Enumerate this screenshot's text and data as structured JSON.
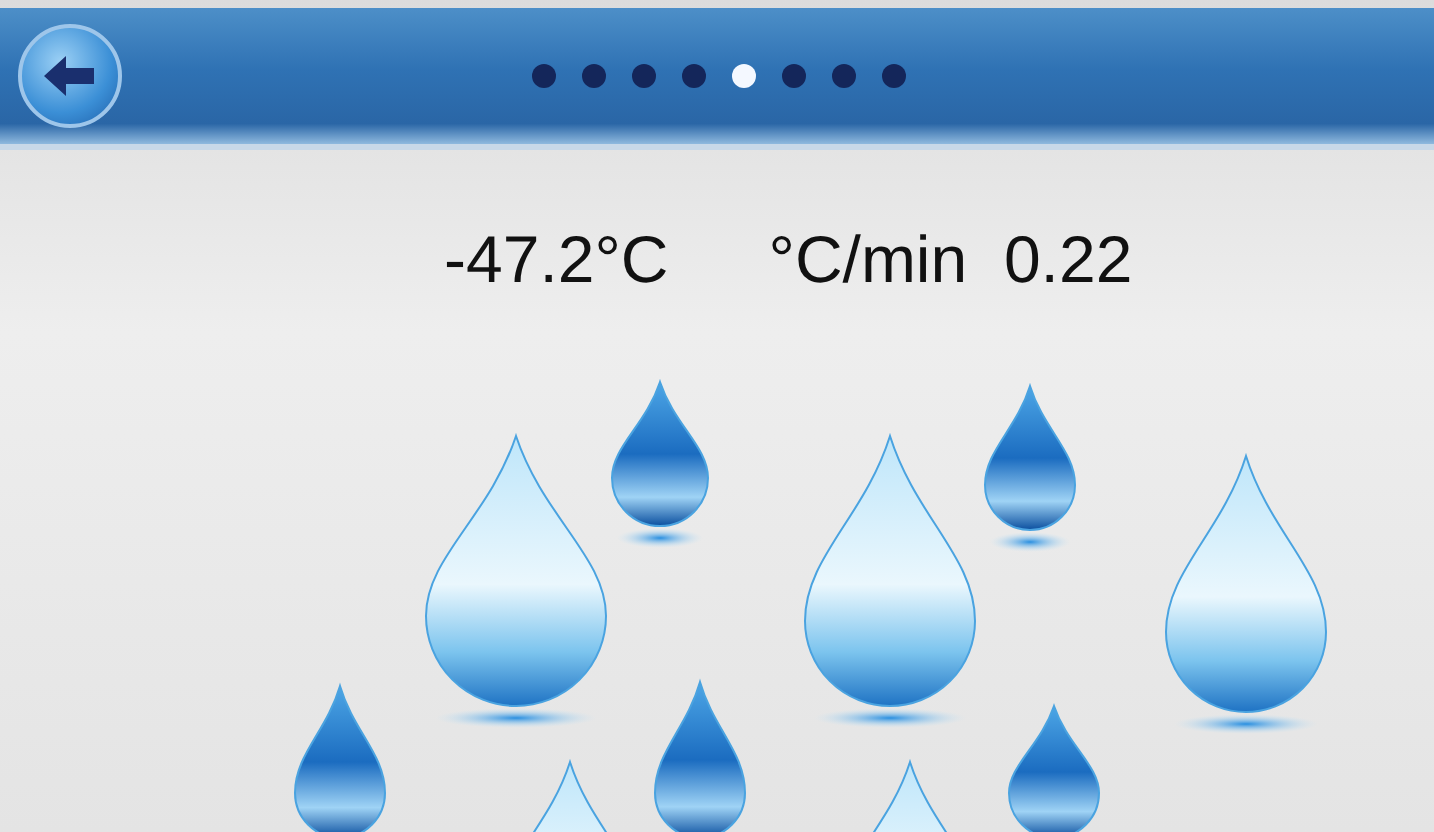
{
  "header": {
    "back_button": true,
    "pager": [
      {
        "selected": false
      },
      {
        "selected": false
      },
      {
        "selected": false
      },
      {
        "selected": false
      },
      {
        "selected": true
      },
      {
        "selected": false
      },
      {
        "selected": false
      },
      {
        "selected": false
      }
    ]
  },
  "readings": {
    "temperature": "-47.2°C",
    "rate": "°C/min  0.22"
  }
}
